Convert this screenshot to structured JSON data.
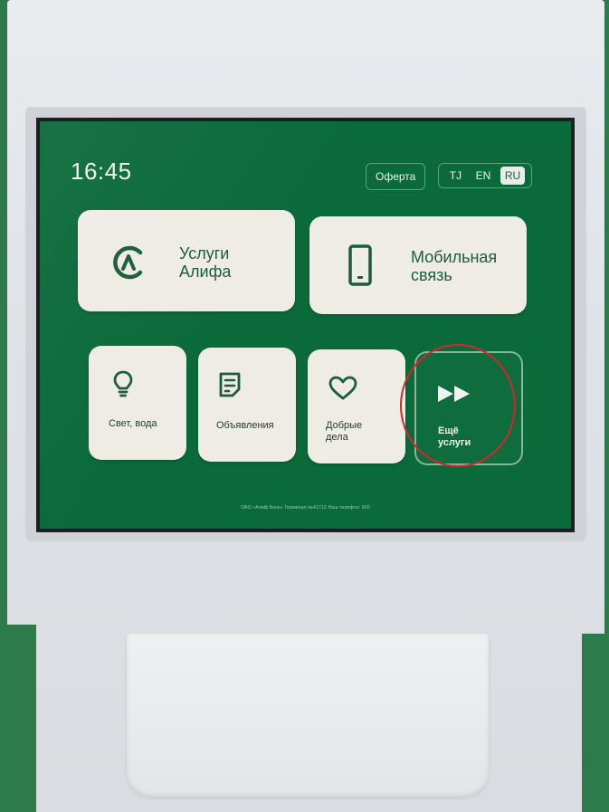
{
  "status": {
    "time": "16:45"
  },
  "header": {
    "offer_label": "Оферта",
    "languages": [
      {
        "code": "TJ",
        "active": false
      },
      {
        "code": "EN",
        "active": false
      },
      {
        "code": "RU",
        "active": true
      }
    ]
  },
  "tiles": {
    "alif": {
      "line1": "Услуги",
      "line2": "Алифа",
      "icon": "alif-logo-icon"
    },
    "mobile": {
      "line1": "Мобильная",
      "line2": "связь",
      "icon": "phone-icon"
    },
    "utilities": {
      "label": "Свет, вода",
      "icon": "lightbulb-icon"
    },
    "ads": {
      "label": "Объявления",
      "icon": "document-icon"
    },
    "charity": {
      "line1": "Добрые",
      "line2": "дела",
      "icon": "heart-icon"
    },
    "more": {
      "line1": "Ещё",
      "line2": "услуги",
      "icon": "fast-forward-icon"
    }
  },
  "footer": {
    "text": "ОАО «Алиф Бонк» Терминал №41712 Наш телефон: 900"
  },
  "colors": {
    "screen_bg": "#0b6a3a",
    "tile_bg": "#efece6",
    "accent": "#1b5d38",
    "annotation": "#d8242c"
  }
}
